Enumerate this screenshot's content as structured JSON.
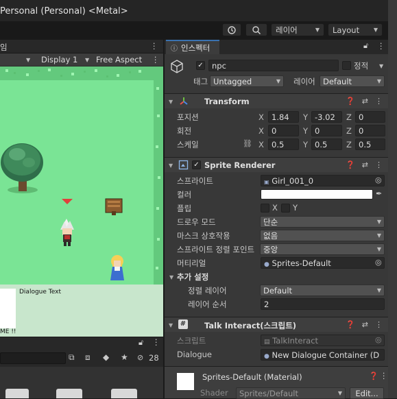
{
  "window": {
    "title": "Personal (Personal) <Metal>"
  },
  "toolbar": {
    "layers_label": "레이어",
    "layout_label": "Layout",
    "history_icon": "history-icon",
    "search_icon": "search-icon"
  },
  "scene": {
    "tab_fragment": "임",
    "display": "Display 1",
    "aspect": "Free Aspect",
    "dialogue_text": "Dialogue Text",
    "dialogue_fragment": "ME !!",
    "hidden_count": "28"
  },
  "inspector": {
    "tab_label": "인스펙터",
    "object_name": "npc",
    "static_label": "정적",
    "tag_label": "태그",
    "tag_value": "Untagged",
    "layer_label": "레이어",
    "layer_value": "Default",
    "transform": {
      "title": "Transform",
      "position_label": "포지션",
      "rotation_label": "회전",
      "scale_label": "스케일",
      "axis_x": "X",
      "axis_y": "Y",
      "axis_z": "Z",
      "position": [
        "1.84",
        "-3.02",
        "0"
      ],
      "rotation": [
        "0",
        "0",
        "0"
      ],
      "scale": [
        "0.5",
        "0.5",
        "0.5"
      ]
    },
    "sprite_renderer": {
      "title": "Sprite Renderer",
      "sprite_label": "스프라이트",
      "sprite_value": "Girl_001_0",
      "color_label": "컬러",
      "color_value": "#ffffff",
      "flip_label": "플립",
      "flip_x": "X",
      "flip_y": "Y",
      "draw_mode_label": "드로우 모드",
      "draw_mode_value": "단순",
      "mask_label": "마스크 상호작용",
      "mask_value": "없음",
      "sort_point_label": "스프라이트 정렬 포인트",
      "sort_point_value": "중앙",
      "material_label": "머티리얼",
      "material_value": "Sprites-Default",
      "additional_label": "추가 설정",
      "sorting_layer_label": "정렬 레이어",
      "sorting_layer_value": "Default",
      "order_label": "레이어 순서",
      "order_value": "2"
    },
    "talk_interact": {
      "title": "Talk Interact(스크립트)",
      "script_label": "스크립트",
      "script_value": "TalkInteract",
      "dialogue_label": "Dialogue",
      "dialogue_value": "New Dialogue Container (D"
    },
    "material": {
      "title": "Sprites-Default (Material)",
      "shader_label": "Shader",
      "shader_value": "Sprites/Default",
      "edit_label": "Edit..."
    }
  }
}
